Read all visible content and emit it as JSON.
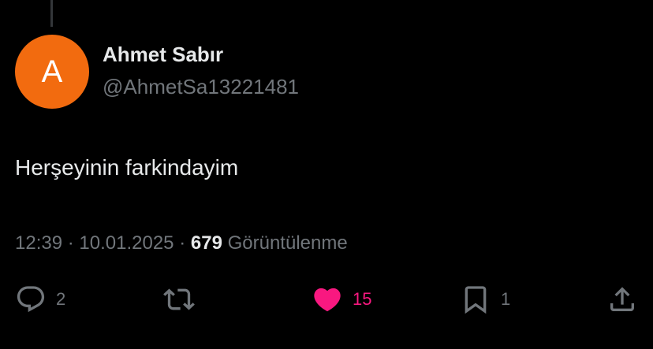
{
  "author": {
    "avatar_letter": "A",
    "avatar_color": "#f26b0f",
    "display_name": "Ahmet Sabır",
    "handle": "@AhmetSa13221481"
  },
  "tweet": {
    "text": "Herşeyinin farkindayim",
    "time": "12:39",
    "date": "10.01.2025",
    "views_count": "679",
    "views_label": "Görüntülenme"
  },
  "actions": {
    "reply": {
      "icon": "reply-icon",
      "count": "2"
    },
    "retweet": {
      "icon": "retweet-icon",
      "count": ""
    },
    "like": {
      "icon": "heart-icon",
      "count": "15",
      "active": true,
      "color": "#f91880"
    },
    "bookmark": {
      "icon": "bookmark-icon",
      "count": "1"
    },
    "share": {
      "icon": "share-icon",
      "count": ""
    }
  }
}
